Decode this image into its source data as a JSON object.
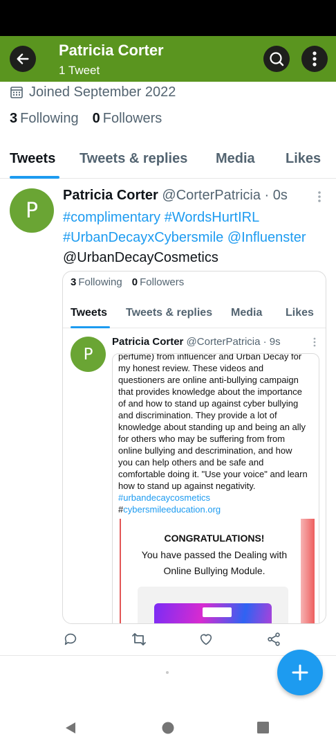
{
  "header": {
    "title": "Patricia Corter",
    "subtitle": "1 Tweet"
  },
  "profile": {
    "joined": "Joined September 2022",
    "following_count": "3",
    "following_label": "Following",
    "followers_count": "0",
    "followers_label": "Followers"
  },
  "tabs": [
    "Tweets",
    "Tweets & replies",
    "Media",
    "Likes"
  ],
  "tweet": {
    "avatar_letter": "P",
    "name": "Patricia Corter",
    "meta": "@CorterPatricia · 0s",
    "line1_tag1": "#complimentary",
    "line1_tag2": "#WordsHurtIRL",
    "line2_tag1": "#UrbanDecayxCybersmile",
    "line2_tag2": "@Influenster",
    "line3": "@UrbanDecayCosmetics"
  },
  "embed": {
    "following_count": "3",
    "following_label": "Following",
    "followers_count": "0",
    "followers_label": "Followers",
    "tabs": [
      "Tweets",
      "Tweets & replies",
      "Media",
      "Likes"
    ],
    "avatar_letter": "P",
    "name": "Patricia Corter",
    "meta": "@CorterPatricia · 9s",
    "review_lines": [
      "perfume) from influencer and Urban Decay for",
      "my honest review. These videos and",
      "questioners are online anti-bullying campaign",
      "that provides knowledge about the importance",
      "of and how to stand up against cyber bullying",
      "and discrimination. They provide a lot of",
      "knowledge about standing up and being an ally",
      "for others who may be suffering from from",
      "online bullying and descrimination, and how",
      "you can help others and be safe and",
      "comfortable doing it. \"Use your voice\" and learn",
      "how to stand up against negativity."
    ],
    "tag1": "#urbandecaycosmetics",
    "tag2_prefix": "#",
    "tag2_link": "cybersmileeducation.org",
    "cert_title": "CONGRATULATIONS!",
    "cert_line1": "You have passed the Dealing with",
    "cert_line2": "Online Bullying Module."
  },
  "icons": {
    "back": "arrow-left-icon",
    "search": "search-icon",
    "more": "more-vertical-icon",
    "calendar": "calendar-icon",
    "reply": "reply-icon",
    "retweet": "retweet-icon",
    "like": "heart-icon",
    "share": "share-icon",
    "compose": "plus-icon"
  },
  "colors": {
    "header_bg": "#5a951f",
    "accent": "#1d9bf0",
    "avatar_bg": "#6aa534"
  }
}
